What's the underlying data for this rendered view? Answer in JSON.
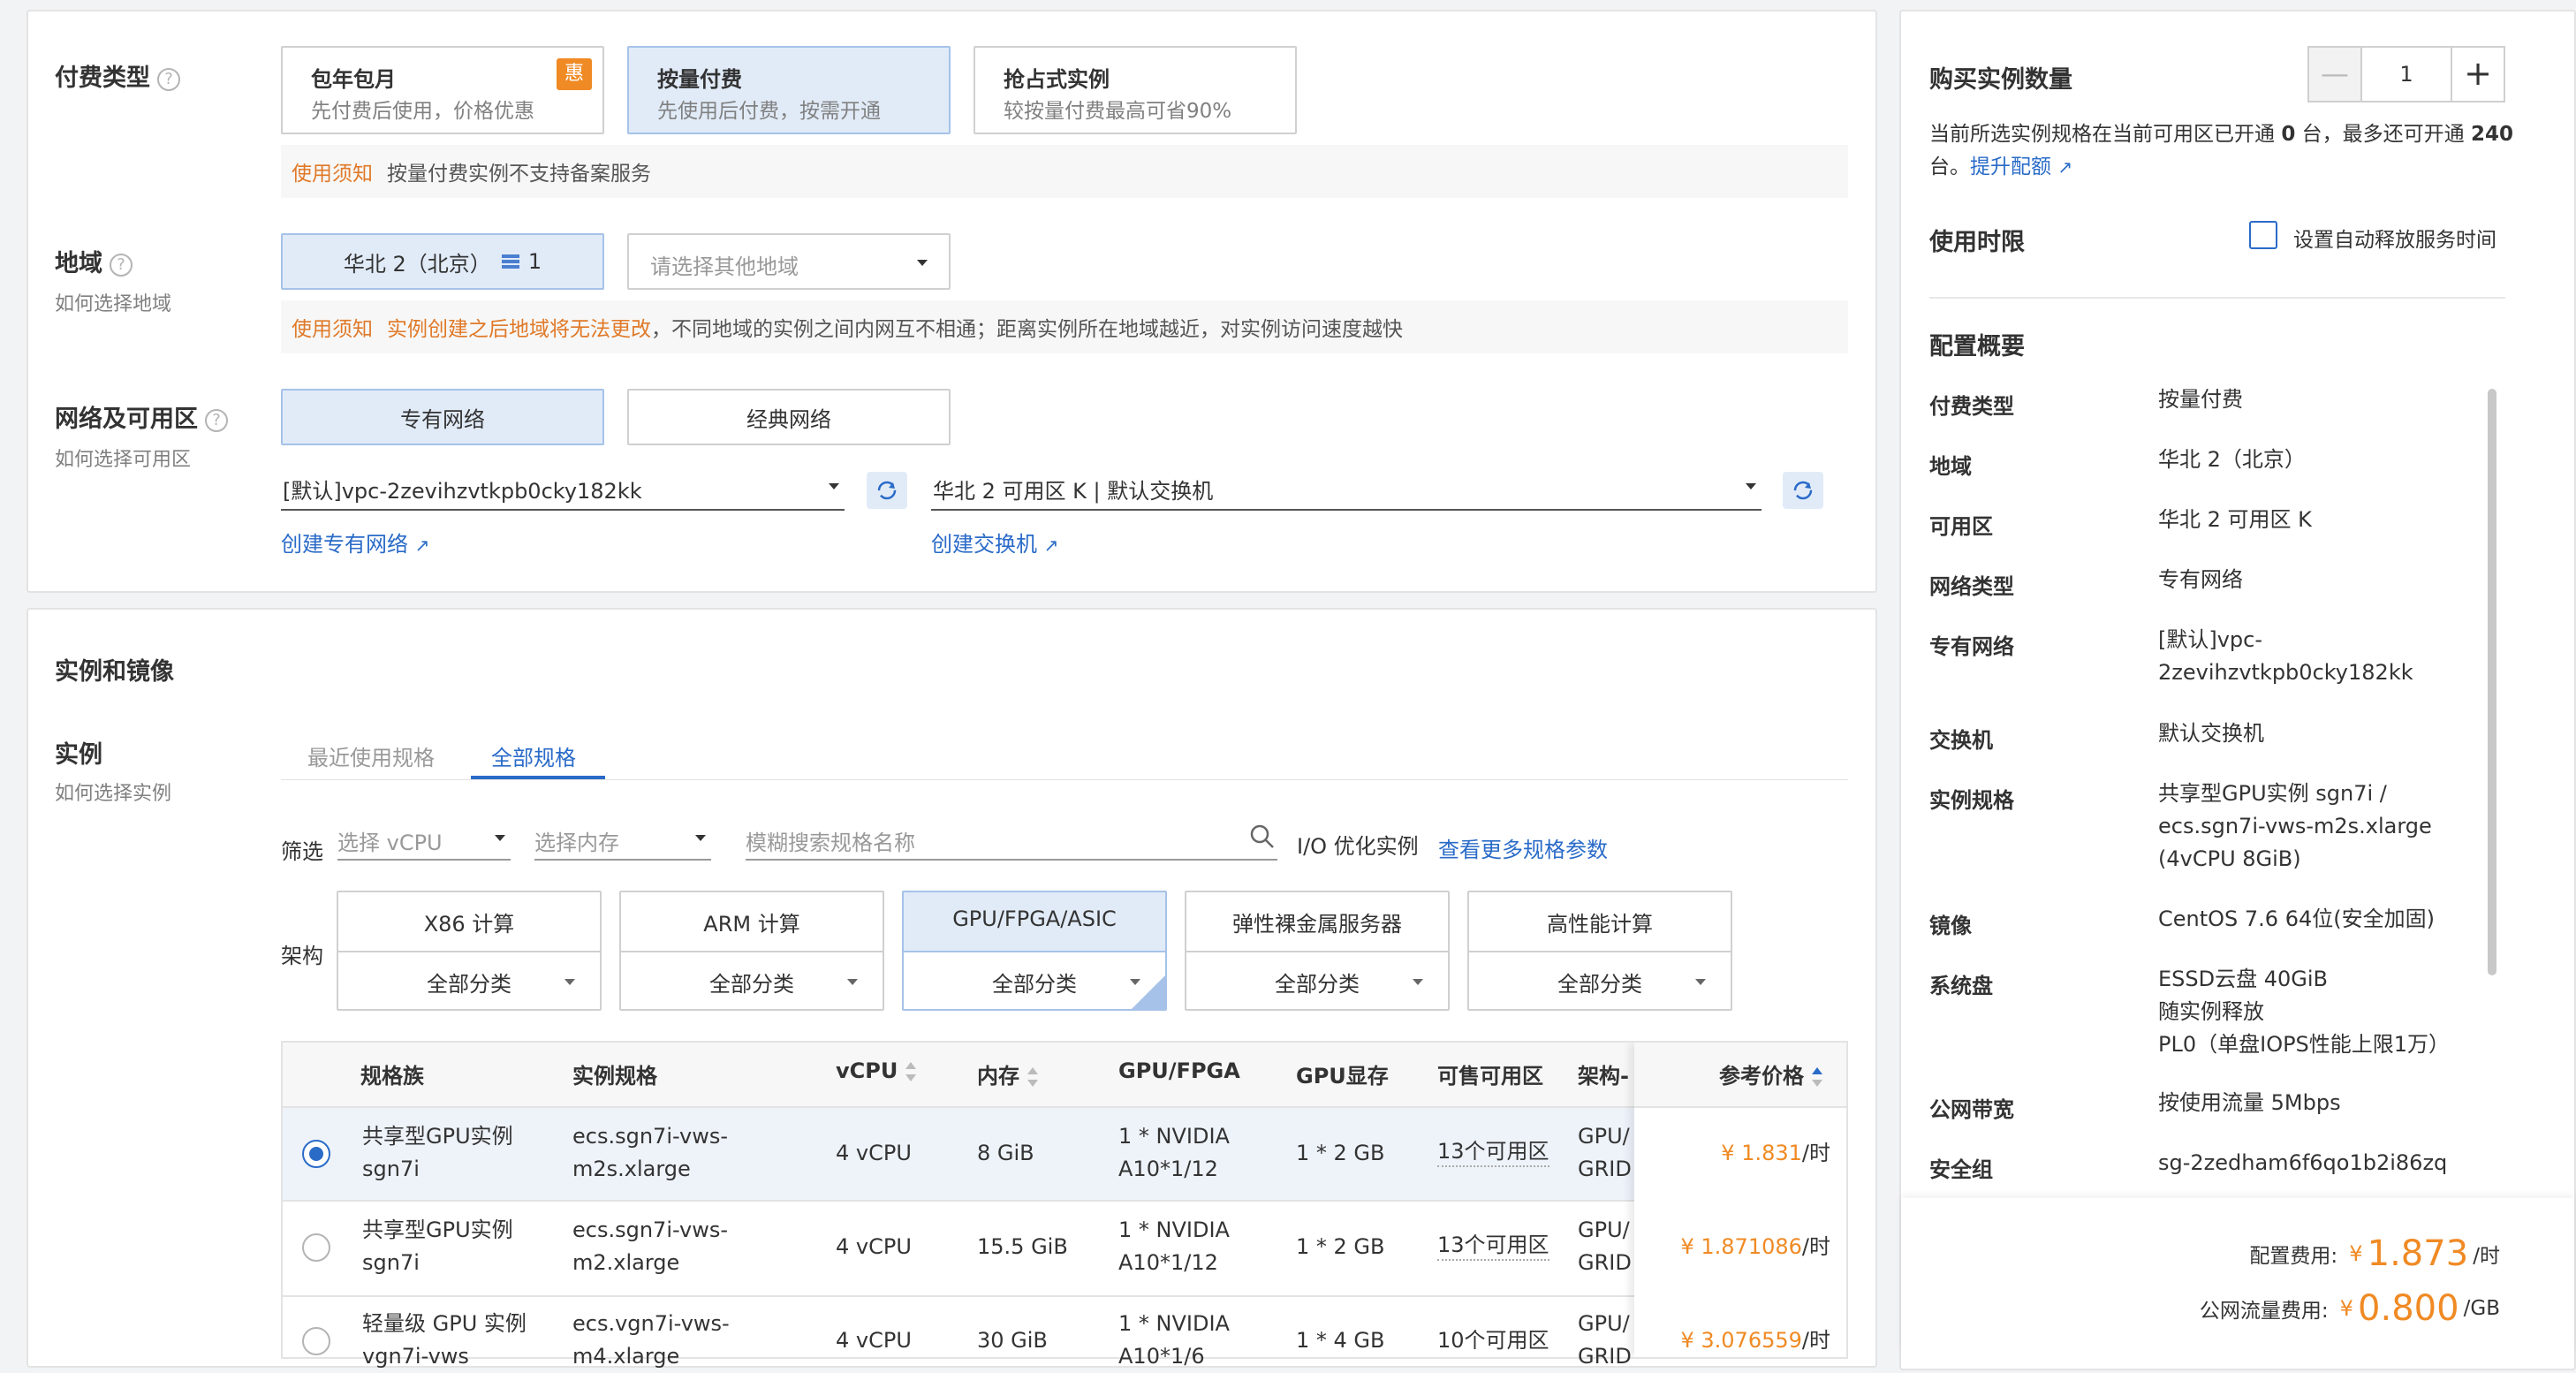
{
  "billing": {
    "label": "付费类型",
    "options": [
      {
        "title": "包年包月",
        "desc": "先付费后使用，价格优惠",
        "badge": "惠"
      },
      {
        "title": "按量付费",
        "desc": "先使用后付费，按需开通"
      },
      {
        "title": "抢占式实例",
        "desc": "较按量付费最高可省90%"
      }
    ],
    "notice_tag": "使用须知",
    "notice_text": "按量付费实例不支持备案服务"
  },
  "region": {
    "label": "地域",
    "help": "如何选择地域",
    "selected": "华北 2（北京）",
    "selected_count": "1",
    "other_placeholder": "请选择其他地域",
    "notice_tag": "使用须知",
    "notice_warn": "实例创建之后地域将无法更改",
    "notice_text": "，不同地域的实例之间内网互不相通；距离实例所在地域越近，对实例访问速度越快"
  },
  "network": {
    "label": "网络及可用区",
    "help": "如何选择可用区",
    "types": [
      "专有网络",
      "经典网络"
    ],
    "vpc_value": "[默认]vpc-2zevihzvtkpb0cky182kk",
    "vswitch_value": "华北 2 可用区 K | 默认交换机",
    "create_vpc": "创建专有网络",
    "create_vswitch": "创建交换机"
  },
  "instance_section": {
    "title": "实例和镜像",
    "label": "实例",
    "help": "如何选择实例",
    "tabs": [
      "最近使用规格",
      "全部规格"
    ],
    "filter_label": "筛选",
    "vcpu_placeholder": "选择 vCPU",
    "mem_placeholder": "选择内存",
    "search_placeholder": "模糊搜索规格名称",
    "io_label": "I/O 优化实例",
    "more_params": "查看更多规格参数",
    "arch_label": "架构",
    "arch": [
      {
        "name": "X86 计算",
        "sub": "全部分类"
      },
      {
        "name": "ARM 计算",
        "sub": "全部分类"
      },
      {
        "name": "GPU/FPGA/ASIC",
        "sub": "全部分类"
      },
      {
        "name": "弹性裸金属服务器",
        "sub": "全部分类"
      },
      {
        "name": "高性能计算",
        "sub": "全部分类"
      }
    ]
  },
  "table": {
    "headers": [
      "规格族",
      "实例规格",
      "vCPU",
      "内存",
      "GPU/FPGA",
      "GPU显存",
      "可售可用区",
      "架构-",
      "参考价格"
    ],
    "rows": [
      {
        "family1": "共享型GPU实例",
        "family2": "sgn7i",
        "spec1": "ecs.sgn7i-vws-",
        "spec2": "m2s.xlarge",
        "vcpu": "4 vCPU",
        "mem": "8 GiB",
        "gpu1": "1 * NVIDIA",
        "gpu2": "A10*1/12",
        "vram": "1 * 2 GB",
        "zones": "13个可用区",
        "arch1": "GPU/F",
        "arch2": "GRID/",
        "price": "¥ 1.831",
        "unit": "/时"
      },
      {
        "family1": "共享型GPU实例",
        "family2": "sgn7i",
        "spec1": "ecs.sgn7i-vws-",
        "spec2": "m2.xlarge",
        "vcpu": "4 vCPU",
        "mem": "15.5 GiB",
        "gpu1": "1 * NVIDIA",
        "gpu2": "A10*1/12",
        "vram": "1 * 2 GB",
        "zones": "13个可用区",
        "arch1": "GPU/F",
        "arch2": "GRID/",
        "price": "¥ 1.871086",
        "unit": "/时"
      },
      {
        "family1": "轻量级 GPU 实例",
        "family2": "vgn7i-vws",
        "spec1": "ecs.vgn7i-vws-",
        "spec2": "m4.xlarge",
        "vcpu": "4 vCPU",
        "mem": "30 GiB",
        "gpu1": "1 * NVIDIA",
        "gpu2": "A10*1/6",
        "vram": "1 * 4 GB",
        "zones": "10个可用区",
        "arch1": "GPU/F",
        "arch2": "GRID/",
        "price": "¥ 3.076559",
        "unit": "/时"
      }
    ]
  },
  "sidebar": {
    "qty_label": "购买实例数量",
    "qty_value": "1",
    "qty_note1": "当前所选实例规格在当前可用区已开通",
    "qty_open": "0",
    "qty_note2": "台，最多还可开通",
    "qty_max": "240",
    "qty_note3": "台。",
    "qty_link": "提升配额",
    "duration_label": "使用时限",
    "auto_release": "设置自动释放服务时间",
    "summary_title": "配置概要",
    "summary": [
      {
        "k": "付费类型",
        "v": [
          "按量付费"
        ]
      },
      {
        "k": "地域",
        "v": [
          "华北 2（北京）"
        ]
      },
      {
        "k": "可用区",
        "v": [
          "华北 2 可用区 K"
        ]
      },
      {
        "k": "网络类型",
        "v": [
          "专有网络"
        ]
      },
      {
        "k": "专有网络",
        "v": [
          "[默认]vpc-",
          "2zevihzvtkpb0cky182kk"
        ]
      },
      {
        "k": "交换机",
        "v": [
          "默认交换机"
        ]
      },
      {
        "k": "实例规格",
        "v": [
          "共享型GPU实例 sgn7i /",
          "ecs.sgn7i-vws-m2s.xlarge",
          "(4vCPU 8GiB)"
        ]
      },
      {
        "k": "镜像",
        "v": [
          "CentOS 7.6 64位(安全加固)"
        ]
      },
      {
        "k": "系统盘",
        "v": [
          "ESSD云盘 40GiB",
          "随实例释放",
          "PL0（单盘IOPS性能上限1万）"
        ]
      },
      {
        "k": "公网带宽",
        "v": [
          "按使用流量 5Mbps"
        ]
      },
      {
        "k": "安全组",
        "v": [
          "sg-2zedham6f6qo1b2i86zq"
        ]
      }
    ],
    "config_fee_label": "配置费用:",
    "config_fee_currency": "¥",
    "config_fee": "1.873",
    "config_fee_unit": "/时",
    "traffic_fee_label": "公网流量费用:",
    "traffic_fee_currency": "¥",
    "traffic_fee": "0.800",
    "traffic_fee_unit": "/GB"
  },
  "colors": {
    "accent": "#2a6bc8",
    "price": "#f08a24",
    "selected_bg": "#e1ebf8",
    "warn": "#e07928"
  }
}
